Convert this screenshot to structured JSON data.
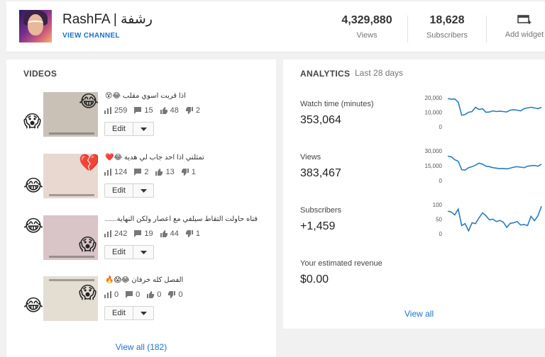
{
  "header": {
    "channel_name": "RashFA | رشفة",
    "view_channel": "VIEW CHANNEL",
    "views_value": "4,329,880",
    "views_label": "Views",
    "subs_value": "18,628",
    "subs_label": "Subscribers",
    "add_widget": "Add widget"
  },
  "videos": {
    "title": "VIDEOS",
    "edit_label": "Edit",
    "view_all": "View all (182)",
    "items": [
      {
        "title": "اذا قربت اسوي مقلب 😂😵",
        "views": "259",
        "comments": "15",
        "likes": "48",
        "dislikes": "2"
      },
      {
        "title": "تمثلني اذا احد جاب لي هدية 😂❤️",
        "views": "124",
        "comments": "2",
        "likes": "13",
        "dislikes": "1"
      },
      {
        "title": "فتاه حاولت التقاط سيلفي مع اعصار ولكن النهاية......",
        "views": "242",
        "comments": "19",
        "likes": "44",
        "dislikes": "1"
      },
      {
        "title": "الفصل كله خرفان 😂😱🔥",
        "views": "0",
        "comments": "0",
        "likes": "0",
        "dislikes": "0"
      }
    ]
  },
  "analytics": {
    "title": "ANALYTICS",
    "period": "Last 28 days",
    "view_all": "View all",
    "metrics": [
      {
        "label": "Watch time (minutes)",
        "value": "353,064",
        "ticks": [
          "20,000",
          "10,000",
          "0"
        ]
      },
      {
        "label": "Views",
        "value": "383,467",
        "ticks": [
          "30,000",
          "15,000",
          "0"
        ]
      },
      {
        "label": "Subscribers",
        "value": "+1,459",
        "ticks": [
          "100",
          "50",
          "0"
        ]
      },
      {
        "label": "Your estimated revenue",
        "value": "$0.00"
      }
    ]
  },
  "chart_data": [
    {
      "type": "line",
      "ylabel": "",
      "ylim": [
        0,
        22000
      ],
      "series": [
        {
          "values": [
            19500,
            19000,
            19200,
            17000,
            8000,
            8500,
            10000,
            10500,
            13500,
            12000,
            12500,
            10000,
            10200,
            11000,
            10500,
            10800,
            10500,
            10200,
            11500,
            11800,
            11500,
            11000,
            12500,
            13000,
            13500,
            13000,
            12500,
            13500
          ]
        }
      ]
    },
    {
      "type": "line",
      "ylabel": "",
      "ylim": [
        0,
        32000
      ],
      "series": [
        {
          "values": [
            24500,
            24000,
            21000,
            19500,
            11000,
            10500,
            13000,
            14000,
            15500,
            17500,
            16500,
            14500,
            14000,
            13000,
            12500,
            12000,
            12200,
            11800,
            12500,
            13500,
            14000,
            13500,
            13000,
            14500,
            15000,
            15200,
            14500,
            16500
          ]
        }
      ]
    },
    {
      "type": "line",
      "ylabel": "",
      "ylim": [
        0,
        110
      ],
      "series": [
        {
          "values": [
            78,
            75,
            65,
            85,
            28,
            35,
            10,
            38,
            35,
            55,
            72,
            62,
            48,
            50,
            42,
            46,
            40,
            22,
            36,
            38,
            42,
            30,
            32,
            28,
            60,
            45,
            62,
            95
          ]
        }
      ]
    }
  ]
}
